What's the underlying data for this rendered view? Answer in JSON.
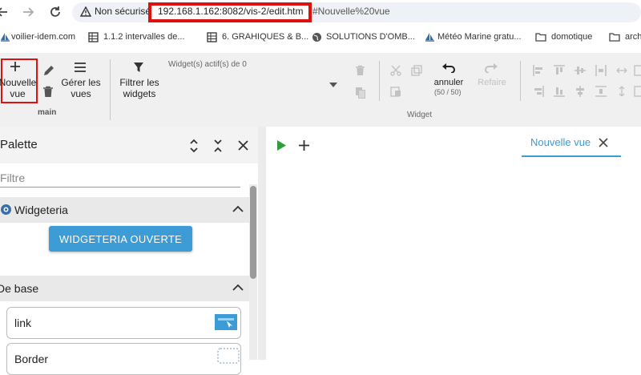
{
  "browser": {
    "back_icon": "arrow-left-icon",
    "forward_icon": "arrow-right-icon",
    "reload_icon": "reload-icon",
    "security_label": "Non sécurisé",
    "url_host_path": "192.168.1.162:8082/vis-2/edit.htm",
    "url_hash": "#Nouvelle%20vue"
  },
  "bookmarks": [
    {
      "label": "voilier-idem.com",
      "icon": "sailboat-icon"
    },
    {
      "label": "1.1.2 intervalles de...",
      "icon": "spreadsheet-icon"
    },
    {
      "label": "6. GRAHIQUES & B...",
      "icon": "spreadsheet-icon"
    },
    {
      "label": "SOLUTIONS D'OMB...",
      "icon": "globe-icon"
    },
    {
      "label": "Météo Marine gratu...",
      "icon": "sailboat-icon"
    },
    {
      "label": "domotique",
      "icon": "folder-icon"
    },
    {
      "label": "arch",
      "icon": "folder-icon"
    }
  ],
  "toolbar": {
    "new_view_label": "Nouvelle vue",
    "manage_views_label": "Gérer les vues",
    "main_group_label": "main",
    "filter_widgets_label": "Filtrer les widgets",
    "active_widgets_label": "Widget(s) actif(s) de 0",
    "undo_label": "annuler",
    "undo_count": "(50 / 50)",
    "redo_label": "Refaire",
    "widget_group_label": "Widget"
  },
  "palette": {
    "title": "Palette",
    "filter_placeholder": "Filtre",
    "sections": [
      {
        "title": "Widgeteria",
        "button_label": "WIDGETERIA OUVERTE"
      },
      {
        "title": "De base"
      }
    ],
    "widgets": [
      {
        "label": "link"
      },
      {
        "label": "Border"
      }
    ]
  },
  "views": {
    "tab_label": "Nouvelle vue"
  },
  "colors": {
    "accent": "#3d9bd6",
    "highlight_red": "#e01010",
    "play_green": "#2e9e3a"
  }
}
